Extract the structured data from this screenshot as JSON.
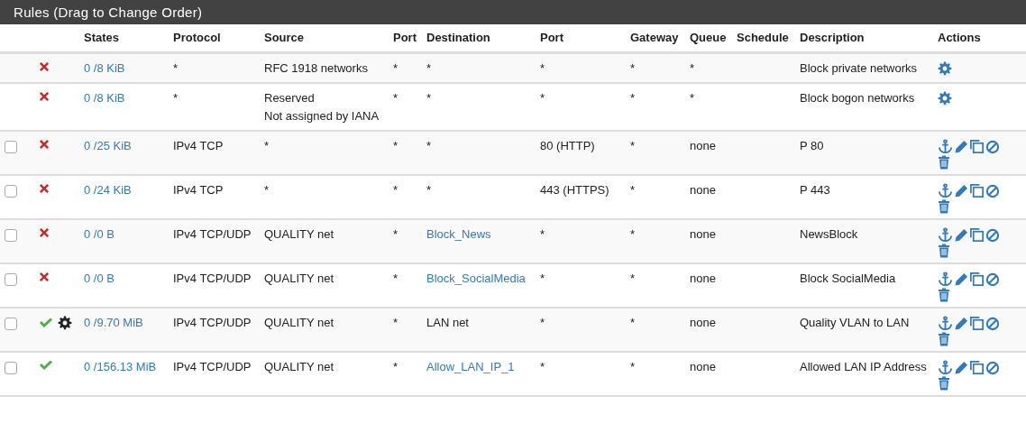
{
  "panel": {
    "title": "Rules (Drag to Change Order)"
  },
  "table": {
    "columns": [
      "",
      "",
      "States",
      "Protocol",
      "Source",
      "Port",
      "Destination",
      "Port",
      "Gateway",
      "Queue",
      "Schedule",
      "Description",
      "Actions"
    ],
    "rows": [
      {
        "kind": "system",
        "passes": false,
        "advanced": false,
        "states": "0 /8 KiB",
        "protocol": "*",
        "source": "RFC 1918 networks",
        "source_port": "*",
        "destination": "*",
        "destination_link": false,
        "destination_port": "*",
        "gateway": "*",
        "queue": "*",
        "description": "Block private networks"
      },
      {
        "kind": "system",
        "passes": false,
        "advanced": false,
        "states": "0 /8 KiB",
        "protocol": "*",
        "source": "Reserved\nNot assigned by IANA",
        "source_port": "*",
        "destination": "*",
        "destination_link": false,
        "destination_port": "*",
        "gateway": "*",
        "queue": "*",
        "description": "Block bogon networks"
      },
      {
        "kind": "user",
        "checked": false,
        "passes": false,
        "advanced": false,
        "states": "0 /25 KiB",
        "protocol": "IPv4 TCP",
        "source": "*",
        "source_port": "*",
        "destination": "*",
        "destination_link": false,
        "destination_port": "80 (HTTP)",
        "gateway": "*",
        "queue": "none",
        "description": "P 80"
      },
      {
        "kind": "user",
        "checked": false,
        "passes": false,
        "advanced": false,
        "states": "0 /24 KiB",
        "protocol": "IPv4 TCP",
        "source": "*",
        "source_port": "*",
        "destination": "*",
        "destination_link": false,
        "destination_port": "443 (HTTPS)",
        "gateway": "*",
        "queue": "none",
        "description": "P 443"
      },
      {
        "kind": "user",
        "checked": false,
        "passes": false,
        "advanced": false,
        "states": "0 /0 B",
        "protocol": "IPv4 TCP/UDP",
        "source": "QUALITY net",
        "source_port": "*",
        "destination": "Block_News",
        "destination_link": true,
        "destination_port": "*",
        "gateway": "*",
        "queue": "none",
        "description": "NewsBlock"
      },
      {
        "kind": "user",
        "checked": false,
        "passes": false,
        "advanced": false,
        "states": "0 /0 B",
        "protocol": "IPv4 TCP/UDP",
        "source": "QUALITY net",
        "source_port": "*",
        "destination": "Block_SocialMedia",
        "destination_link": true,
        "destination_port": "*",
        "gateway": "*",
        "queue": "none",
        "description": "Block SocialMedia"
      },
      {
        "kind": "user",
        "checked": false,
        "passes": true,
        "advanced": true,
        "states": "0 /9.70 MiB",
        "protocol": "IPv4 TCP/UDP",
        "source": "QUALITY net",
        "source_port": "*",
        "destination": "LAN net",
        "destination_link": false,
        "destination_port": "*",
        "gateway": "*",
        "queue": "none",
        "description": "Quality VLAN to LAN"
      },
      {
        "kind": "user",
        "checked": false,
        "passes": true,
        "advanced": false,
        "states": "0 /156.13 MiB",
        "protocol": "IPv4 TCP/UDP",
        "source": "QUALITY net",
        "source_port": "*",
        "destination": "Allow_LAN_IP_1",
        "destination_link": true,
        "destination_port": "*",
        "gateway": "*",
        "queue": "none",
        "description": "Allowed LAN IP Address"
      }
    ]
  }
}
